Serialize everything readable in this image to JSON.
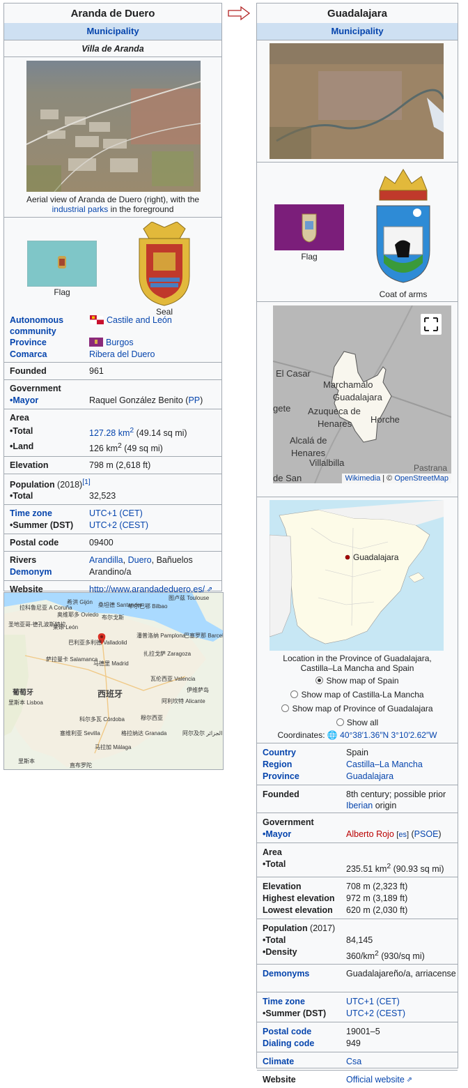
{
  "left": {
    "title": "Aranda de Duero",
    "band": "Municipality",
    "native_name": "Villa de Aranda",
    "caption_pre": "Aerial view of Aranda de Duero (right), with the ",
    "caption_link": "industrial parks",
    "caption_post": " in the foreground",
    "flag_label": "Flag",
    "seal_label": "Seal",
    "rows": {
      "autonomous_label": "Autonomous community",
      "autonomous_value": "Castile and León",
      "province_label": "Province",
      "province_value": "Burgos",
      "comarca_label": "Comarca",
      "comarca_value": "Ribera del Duero",
      "founded_label": "Founded",
      "founded_value": "961",
      "government_label": "Government",
      "mayor_label": "Mayor",
      "mayor_value": "Raquel González Benito",
      "mayor_party": "PP",
      "area_label": "Area",
      "total_label": "Total",
      "area_total_value": "127.28 km",
      "area_total_extra": " (49.14 sq mi)",
      "land_label": "Land",
      "land_value": "126 km",
      "land_extra": " (49 sq mi)",
      "elevation_label": "Elevation",
      "elevation_value": "798 m (2,618 ft)",
      "population_label": "Population",
      "population_year": " (2018)",
      "population_ref": "[1]",
      "pop_total_label": "Total",
      "pop_total_value": "32,523",
      "timezone_label": "Time zone",
      "timezone_value": "UTC+1 (CET)",
      "summer_label": "Summer (DST)",
      "summer_value": "UTC+2 (CEST)",
      "postal_label": "Postal code",
      "postal_value": "09400",
      "rivers_label": "Rivers",
      "rivers_value_1": "Arandilla",
      "rivers_value_2": "Duero",
      "rivers_value_3": "Bañuelos",
      "demonym_label": "Demonym",
      "demonym_value": "Arandino/a",
      "website_label": "Website",
      "website_value": "http://www.arandadeduero.es/"
    }
  },
  "map_cn": {
    "labels": [
      "拉科鲁尼亚 A Coruña",
      "希洪 Gijón",
      "桑坦德 Santander",
      "毕尔巴鄂 Bilbao",
      "图卢兹 Toulouse",
      "奥维耶多 Oviedo",
      "圣地亚哥-德孔波斯特拉",
      "布尔戈斯",
      "莱昂 León",
      "潘普洛纳 Pamplona",
      "扎拉戈萨 Zaragoza",
      "巴塞罗那 Barcelona",
      "巴利亚多利德 Valladolid",
      "萨拉曼卡 Salamanca",
      "马德里 Madrid",
      "西班牙",
      "瓦伦西亚 Valencia",
      "葡萄牙",
      "里斯本 Lisboa",
      "科尔多瓦 Córdoba",
      "塞维利亚 Sevilla",
      "格拉纳达 Granada",
      "马拉加 Málaga",
      "穆尔西亚",
      "阿利坎特 Alicante",
      "伊维萨岛",
      "阿尔及尔 الجزائر",
      "里斯本",
      "直布罗陀"
    ]
  },
  "right": {
    "title": "Guadalajara",
    "band": "Municipality",
    "flag_label": "Flag",
    "coat_label": "Coat of arms",
    "map_attr_1": "Wikimedia",
    "map_attr_sep": " | © ",
    "map_attr_2": "OpenStreetMap",
    "map_places": [
      "El Casar",
      "Marchamalo",
      "Guadalajara",
      "Azuqueca de",
      "Henares",
      "Horche",
      "Alcalá de",
      "Henares",
      "Villalbilla",
      "gete",
      "de San",
      "Pastrana"
    ],
    "spain_marker": "Guadalajara",
    "location_caption": "Location in the Province of Guadalajara, Castilla–La Mancha and Spain",
    "radios": [
      "Show map of Spain",
      "Show map of Castilla-La Mancha",
      "Show map of Province of Guadalajara",
      "Show all"
    ],
    "coords_label": "Coordinates: ",
    "coords_value": "40°38′1.36″N 3°10′2.62″W",
    "rows": {
      "country_label": "Country",
      "country_value": "Spain",
      "region_label": "Region",
      "region_value": "Castilla–La Mancha",
      "province_label": "Province",
      "province_value": "Guadalajara",
      "founded_label": "Founded",
      "founded_value_1": "8th century; possible prior ",
      "founded_value_2": "Iberian",
      "founded_value_3": " origin",
      "government_label": "Government",
      "mayor_label": "Mayor",
      "mayor_value": "Alberto Rojo",
      "mayor_lang": "es",
      "mayor_party": "PSOE",
      "area_label": "Area",
      "total_label": "Total",
      "area_total_value": "235.51 km",
      "area_total_extra": " (90.93 sq mi)",
      "elevation_label": "Elevation",
      "elevation_value": "708 m (2,323 ft)",
      "highest_label": "Highest elevation",
      "highest_value": "972 m (3,189 ft)",
      "lowest_label": "Lowest elevation",
      "lowest_value": "620 m (2,030 ft)",
      "population_label": "Population",
      "population_year": " (2017)",
      "pop_total_label": "Total",
      "pop_total_value": "84,145",
      "density_label": "Density",
      "density_value": "360/km",
      "density_extra": " (930/sq mi)",
      "demonyms_label": "Demonyms",
      "demonyms_value": "Guadalajareño/a, arriacense",
      "timezone_label": "Time zone",
      "timezone_value": "UTC+1 (CET)",
      "summer_label": "Summer (DST)",
      "summer_value": "UTC+2 (CEST)",
      "postal_label": "Postal code",
      "postal_value": "19001–5",
      "dialing_label": "Dialing code",
      "dialing_value": "949",
      "climate_label": "Climate",
      "climate_value": "Csa",
      "website_label": "Website",
      "website_value": "Official website"
    }
  },
  "colors": {
    "band": "#cee0f2",
    "link": "#0645ad",
    "border": "#a2a9b1",
    "redlink": "#ba0000",
    "arrow": "#b22222"
  }
}
